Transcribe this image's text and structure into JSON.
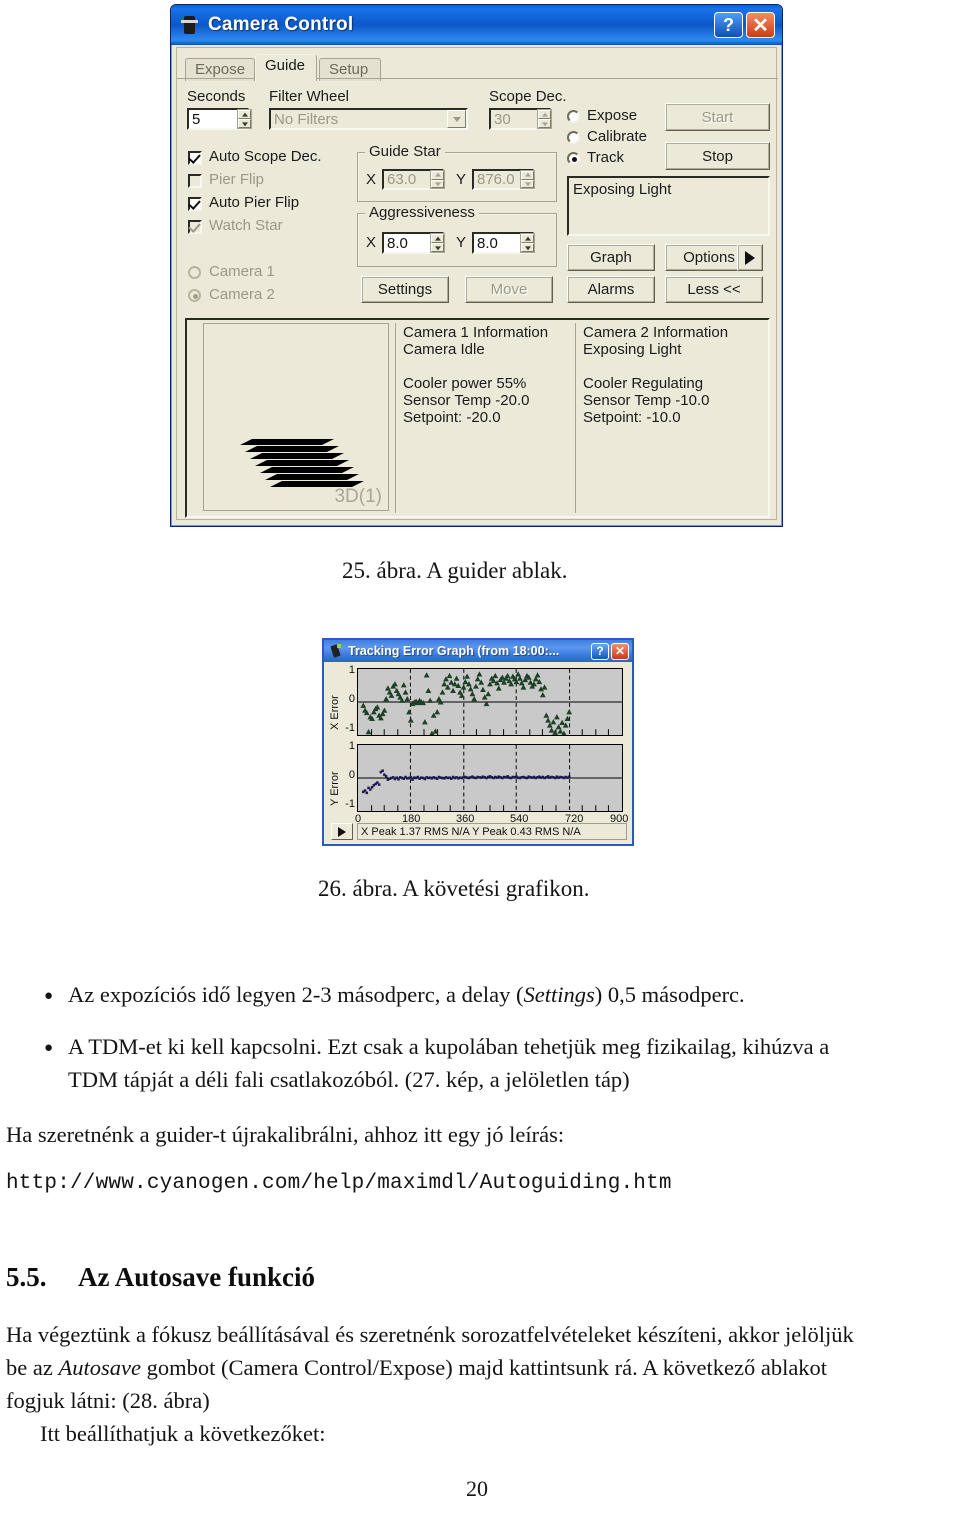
{
  "camera_control": {
    "title": "Camera Control",
    "titlebar_icon": "camera-icon",
    "help_label": "?",
    "close_label": "✕",
    "tabs": [
      {
        "label": "Expose",
        "active": false
      },
      {
        "label": "Guide",
        "active": true
      },
      {
        "label": "Setup",
        "active": false
      }
    ],
    "seconds_label": "Seconds",
    "seconds_value": "5",
    "filter_wheel_label": "Filter Wheel",
    "filter_wheel_value": "No Filters",
    "scope_dec_label": "Scope Dec.",
    "scope_dec_value": "30",
    "mode_radios": [
      {
        "label": "Expose",
        "selected": false
      },
      {
        "label": "Calibrate",
        "selected": false
      },
      {
        "label": "Track",
        "selected": true
      }
    ],
    "start_label": "Start",
    "stop_label": "Stop",
    "status_text": "Exposing Light",
    "checkboxes": [
      {
        "label": "Auto Scope Dec.",
        "checked": true,
        "disabled": false
      },
      {
        "label": "Pier Flip",
        "checked": false,
        "disabled": true
      },
      {
        "label": "Auto Pier Flip",
        "checked": true,
        "disabled": false
      },
      {
        "label": "Watch Star",
        "checked": true,
        "disabled": true
      }
    ],
    "camera_radios": [
      {
        "label": "Camera 1",
        "selected": false
      },
      {
        "label": "Camera 2",
        "selected": true
      }
    ],
    "guide_star": {
      "title": "Guide Star",
      "x_label": "X",
      "x_value": "63.0",
      "y_label": "Y",
      "y_value": "876.0"
    },
    "aggressiveness": {
      "title": "Aggressiveness",
      "x_label": "X",
      "x_value": "8.0",
      "y_label": "Y",
      "y_value": "8.0"
    },
    "buttons": {
      "settings": "Settings",
      "move": "Move",
      "graph": "Graph",
      "options": "Options",
      "alarms": "Alarms",
      "less": "Less <<"
    },
    "preview_tag": "3D(1)",
    "camera1_info": "Camera 1 Information\nCamera Idle\n\nCooler power 55%\nSensor Temp -20.0\nSetpoint: -20.0",
    "camera2_info": "Camera 2 Information\nExposing Light\n\nCooler Regulating\nSensor Temp -10.0\nSetpoint: -10.0"
  },
  "tracking_graph": {
    "title": "Tracking Error Graph (from 18:00:...",
    "help_label": "?",
    "close_label": "✕",
    "status_text": "X Peak 1.37   RMS N/A        Y Peak 0.43   RMS N/A",
    "scroll_arrow": "play-arrow-icon"
  },
  "chart_data": [
    {
      "type": "scatter",
      "title": "X Error",
      "ylabel": "X Error",
      "xlabel": "",
      "ylim": [
        -1,
        1
      ],
      "xlim": [
        0,
        900
      ],
      "yticks": [
        "1",
        "0",
        "-1"
      ],
      "grid": true,
      "marker": "triangle",
      "color": "#1d4026",
      "x": [
        18,
        24,
        30,
        36,
        42,
        48,
        54,
        60,
        66,
        72,
        78,
        84,
        90,
        96,
        102,
        108,
        114,
        120,
        126,
        132,
        138,
        144,
        150,
        156,
        162,
        168,
        174,
        180,
        186,
        192,
        198,
        204,
        210,
        216,
        222,
        228,
        234,
        240,
        246,
        252,
        258,
        264,
        270,
        276,
        282,
        288,
        294,
        300,
        306,
        312,
        318,
        324,
        330,
        336,
        342,
        348,
        354,
        360,
        366,
        372,
        378,
        384,
        390,
        396,
        402,
        408,
        414,
        420,
        426,
        432,
        438,
        444,
        450,
        456,
        462,
        468,
        474,
        480,
        486,
        492,
        498,
        504,
        510,
        516,
        522,
        528,
        534,
        540,
        546,
        552,
        558,
        564,
        570,
        576,
        582,
        588,
        594,
        600,
        606,
        612,
        618,
        624,
        630,
        636,
        642,
        648,
        654,
        660,
        666,
        672,
        678,
        684,
        690,
        696,
        702,
        708,
        714,
        720
      ],
      "y": [
        -0.1,
        -0.25,
        -0.32,
        -0.9,
        -0.45,
        -0.5,
        -0.3,
        -0.2,
        -0.15,
        -0.4,
        -0.48,
        -0.35,
        -0.25,
        0.1,
        0.42,
        0.3,
        0.2,
        0.48,
        0.55,
        0.35,
        0.25,
        0.15,
        0.05,
        0.52,
        0.3,
        0.1,
        -0.3,
        -0.55,
        -0.05,
        0.0,
        0.02,
        -0.02,
        0.05,
        0.0,
        -0.02,
        -0.6,
        0.82,
        0.35,
        0.05,
        -0.95,
        -0.4,
        -0.88,
        -0.3,
        0.1,
        0.0,
        0.3,
        0.55,
        0.7,
        0.45,
        0.8,
        0.6,
        0.35,
        0.55,
        0.72,
        0.5,
        0.3,
        0.2,
        0.45,
        0.62,
        0.78,
        0.55,
        0.4,
        0.25,
        0.1,
        0.48,
        0.7,
        0.85,
        0.6,
        0.38,
        0.15,
        -0.05,
        0.25,
        0.55,
        0.72,
        0.65,
        0.8,
        0.58,
        0.42,
        0.68,
        0.75,
        0.6,
        0.72,
        0.8,
        0.65,
        0.55,
        0.78,
        0.7,
        0.62,
        0.85,
        0.72,
        0.58,
        0.45,
        0.68,
        0.8,
        0.75,
        0.6,
        0.48,
        0.55,
        0.7,
        0.82,
        0.62,
        0.4,
        0.22,
        0.45,
        -0.4,
        -0.55,
        -0.7,
        -0.85,
        -0.6,
        -0.92,
        -0.45,
        -0.75,
        -0.88,
        -0.62,
        -0.95,
        -0.7,
        -0.5,
        -0.3
      ]
    },
    {
      "type": "scatter",
      "title": "Y Error",
      "ylabel": "Y Error",
      "xlabel": "",
      "ylim": [
        -1,
        1
      ],
      "xlim": [
        0,
        900
      ],
      "yticks": [
        "1",
        "0",
        "-1"
      ],
      "xticks": [
        "0",
        "180",
        "360",
        "540",
        "720",
        "900"
      ],
      "grid": true,
      "marker": "dot",
      "color": "#1a1a4e",
      "x": [
        18,
        24,
        30,
        36,
        42,
        48,
        54,
        60,
        66,
        72,
        78,
        84,
        90,
        96,
        102,
        108,
        114,
        120,
        126,
        132,
        138,
        144,
        150,
        156,
        162,
        168,
        174,
        180,
        186,
        192,
        198,
        204,
        210,
        216,
        222,
        228,
        234,
        240,
        246,
        252,
        258,
        264,
        270,
        276,
        282,
        288,
        294,
        300,
        306,
        312,
        318,
        324,
        330,
        336,
        342,
        348,
        354,
        360,
        366,
        372,
        378,
        384,
        390,
        396,
        402,
        408,
        414,
        420,
        426,
        432,
        438,
        444,
        450,
        456,
        462,
        468,
        474,
        480,
        486,
        492,
        498,
        504,
        510,
        516,
        522,
        528,
        534,
        540,
        546,
        552,
        558,
        564,
        570,
        576,
        582,
        588,
        594,
        600,
        606,
        612,
        618,
        624,
        630,
        636,
        642,
        648,
        654,
        660,
        666,
        672,
        678,
        684,
        690,
        696,
        702,
        708,
        714,
        720
      ],
      "y": [
        -0.42,
        -0.38,
        -0.45,
        -0.3,
        -0.35,
        -0.28,
        -0.22,
        -0.18,
        -0.14,
        -0.2,
        0.18,
        0.22,
        0.1,
        0.05,
        -0.05,
        -0.02,
        0.0,
        0.02,
        -0.03,
        0.01,
        -0.04,
        0.02,
        0.0,
        -0.02,
        0.03,
        -0.01,
        0.0,
        0.02,
        -0.05,
        0.01,
        0.0,
        0.03,
        -0.02,
        0.01,
        0.0,
        -0.03,
        0.02,
        0.0,
        0.01,
        -0.01,
        0.02,
        0.0,
        -0.02,
        0.03,
        0.01,
        0.0,
        -0.01,
        0.02,
        0.0,
        0.01,
        -0.02,
        0.03,
        0.0,
        0.02,
        -0.01,
        0.01,
        0.0,
        0.02,
        0.03,
        0.01,
        0.0,
        0.02,
        0.04,
        0.01,
        0.0,
        0.03,
        0.02,
        0.01,
        0.04,
        0.02,
        0.0,
        0.03,
        0.05,
        0.02,
        0.0,
        0.03,
        0.01,
        0.04,
        0.02,
        0.0,
        0.03,
        0.02,
        0.05,
        0.01,
        0.0,
        0.03,
        0.02,
        0.04,
        0.01,
        0.0,
        0.02,
        0.03,
        0.01,
        0.0,
        0.04,
        0.02,
        0.01,
        0.03,
        0.0,
        0.02,
        0.04,
        0.01,
        0.03,
        0.0,
        0.02,
        0.05,
        0.01,
        0.03,
        0.02,
        0.0,
        0.04,
        0.01,
        0.03,
        0.02,
        0.0,
        0.03,
        0.01,
        0.04,
        0.02
      ]
    }
  ],
  "document": {
    "caption_25": "25. ábra. A guider ablak.",
    "caption_26": "26. ábra. A követési grafikon.",
    "bullet_glyph": "●",
    "bullet_1": "Az expozíciós idő legyen 2-3 másodperc, a delay (Settings) 0,5 másodperc.",
    "bullet_1_pre": "Az expozíciós idő legyen 2-3 másodperc, a delay (",
    "bullet_1_em": "Settings",
    "bullet_1_post": ") 0,5 másodperc.",
    "bullet_2_line1": "A TDM-et ki kell kapcsolni. Ezt csak a kupolában tehetjük meg fizikailag, kihúzva a",
    "bullet_2_line2": "TDM tápját a déli fali csatlakozóból. (27. kép, a jelöletlen táp)",
    "para_recalib": "Ha szeretnénk a guider-t újrakalibrálni, ahhoz itt egy jó leírás:",
    "url": "http://www.cyanogen.com/help/maximdl/Autoguiding.htm",
    "section_number": "5.5.",
    "section_title": "Az Autosave funkció",
    "para_autosave_l1": "Ha végeztünk a fókusz beállításával és szeretnénk sorozatfelvételeket készíteni, akkor jelöljük",
    "para_autosave_l2_pre": "be az ",
    "para_autosave_l2_em": "Autosave",
    "para_autosave_l2_post": " gombot (Camera Control/Expose) majd kattintsunk rá. A következő ablakot",
    "para_autosave_l3": "fogjuk látni: (28. ábra)",
    "para_autosave_l4": "Itt beállíthatjuk a következőket:",
    "page_number": "20"
  }
}
